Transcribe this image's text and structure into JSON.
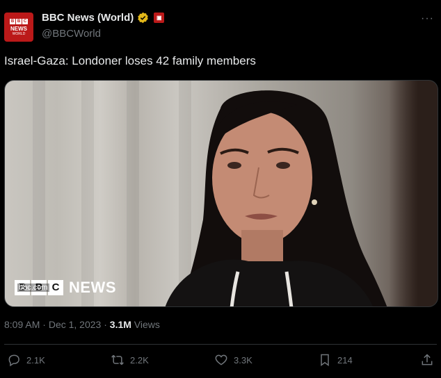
{
  "author": {
    "display_name": "BBC News (World)",
    "handle": "@BBCWorld",
    "avatar_line1": "NEWS",
    "avatar_line2": "WORLD",
    "avatar_letters": [
      "B",
      "B",
      "C"
    ]
  },
  "tweet": {
    "text": "Israel-Gaza: Londoner loses 42 family members",
    "time": "8:09 AM",
    "date": "Dec 1, 2023",
    "views_count": "3.1M",
    "views_label": "Views"
  },
  "media": {
    "watermark_letters": [
      "B",
      "B",
      "C"
    ],
    "watermark_news": "NEWS",
    "watermark_site": "bbc.com"
  },
  "actions": {
    "replies": "2.1K",
    "reposts": "2.2K",
    "likes": "3.3K",
    "bookmarks": "214"
  },
  "colors": {
    "brand_red": "#bb1919",
    "verified_gold": "#e2b719",
    "text_primary": "#e7e9ea",
    "text_secondary": "#71767b"
  }
}
